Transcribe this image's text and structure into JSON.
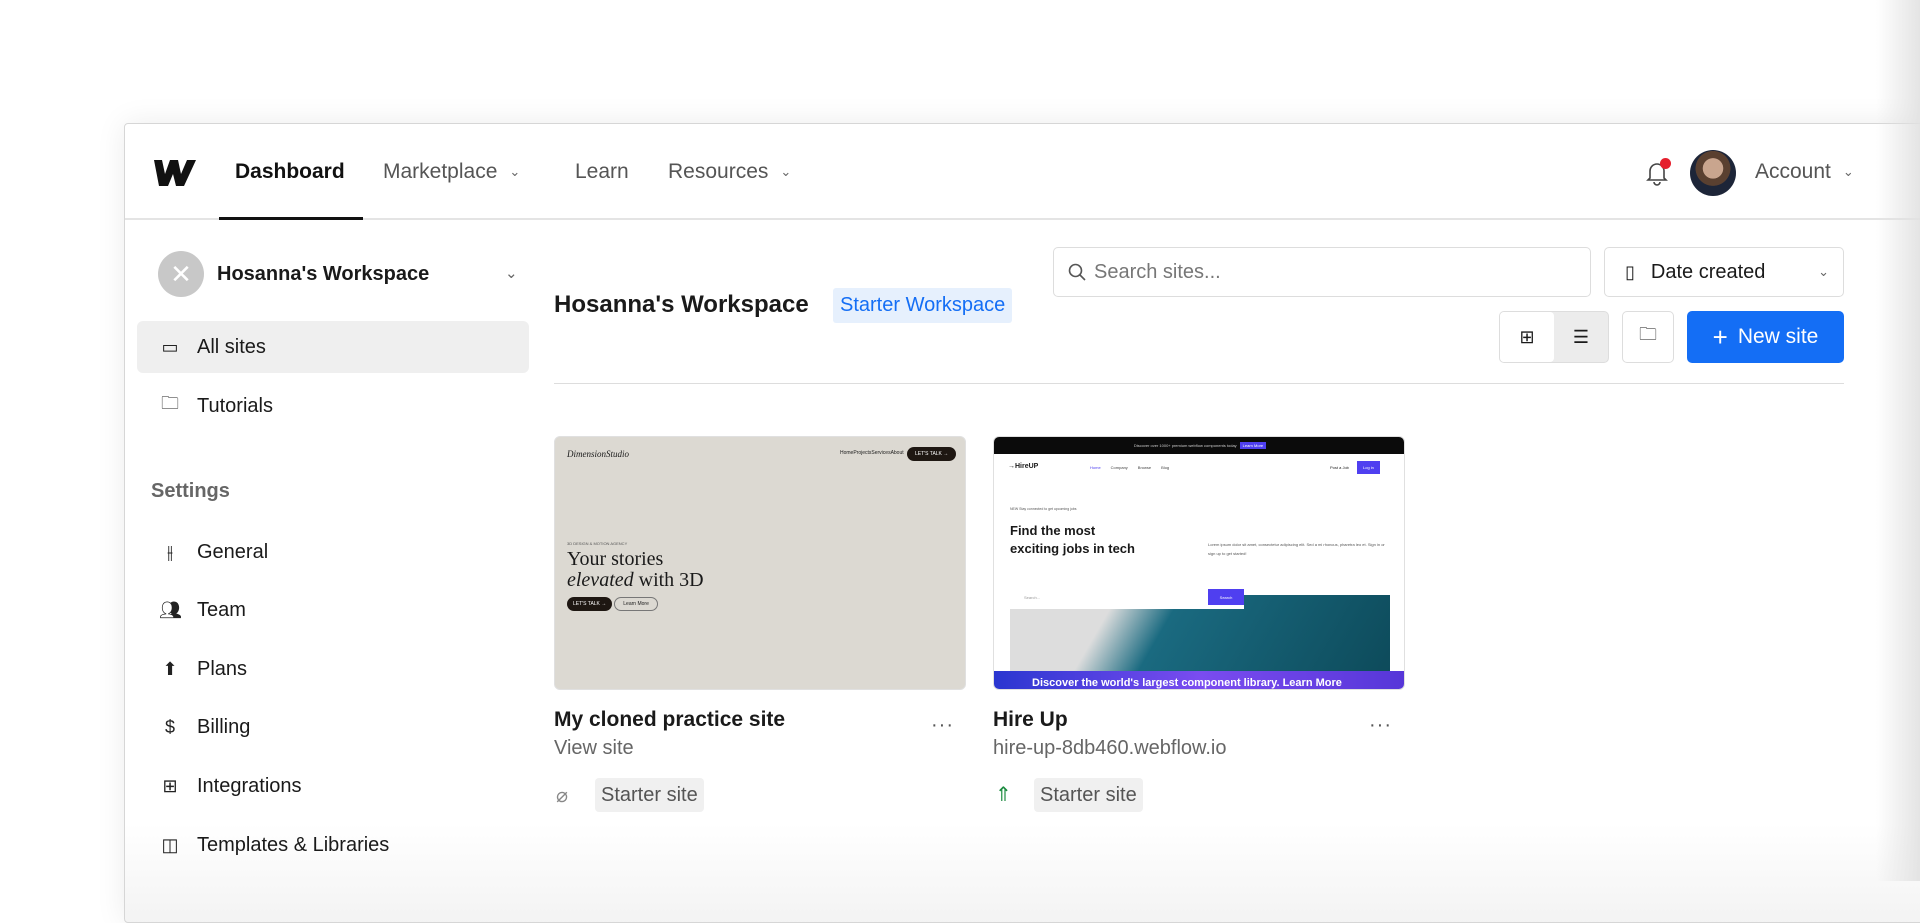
{
  "nav": {
    "dashboard": "Dashboard",
    "marketplace": "Marketplace",
    "learn": "Learn",
    "resources": "Resources",
    "account": "Account"
  },
  "sidebar": {
    "workspace": "Hosanna's Workspace",
    "all_sites": "All sites",
    "tutorials": "Tutorials",
    "settings_heading": "Settings",
    "items": [
      {
        "label": "General"
      },
      {
        "label": "Team"
      },
      {
        "label": "Plans"
      },
      {
        "label": "Billing"
      },
      {
        "label": "Integrations"
      },
      {
        "label": "Templates & Libraries"
      }
    ]
  },
  "main": {
    "title": "Hosanna's Workspace",
    "plan_badge": "Starter Workspace",
    "search_placeholder": "Search sites...",
    "sort": "Date created",
    "new_site": "New site",
    "sites": [
      {
        "title": "My cloned practice site",
        "subtitle": "View site",
        "badge": "Starter site",
        "thumb": {
          "brand": "DimensionStudio",
          "nav": "HomeProjectsServicesAbout",
          "cta": "LET'S TALK →",
          "kicker": "3D DESIGN & MOTION AGENCY",
          "headline1": "Your stories",
          "headline2a": "elevated",
          "headline2b": " with 3D",
          "btn1": "LET'S TALK →",
          "btn2": "Learn More"
        }
      },
      {
        "title": "Hire Up",
        "subtitle": "hire-up-8db460.webflow.io",
        "badge": "Starter site",
        "thumb": {
          "banner": "Discover over 1000+ premium webflow components today",
          "banner_btn": "Learn More",
          "brand": "→HireUP",
          "links": [
            "Home",
            "Company",
            "Browse",
            "Blog"
          ],
          "post": "Post a Job",
          "login": "Log in",
          "tag": "NEW  Stay connected to get upcoming jobs",
          "headline1": "Find the most",
          "headline2": "exciting jobs in tech",
          "body": "Lorem ipsum dolor sit amet, consectetur adipiscing elit. Sed a mi rhoncus, pharetra leo et. Sign in or sign up to get started!",
          "search": "Search...",
          "search_btn": "Search",
          "footer": "Discover the world's largest component library. Learn More"
        }
      }
    ]
  },
  "colors": {
    "accent": "#146ef5",
    "badge_bg": "#e6f0fd",
    "notif": "#e5202e",
    "rocket": "#1a8a3e"
  }
}
